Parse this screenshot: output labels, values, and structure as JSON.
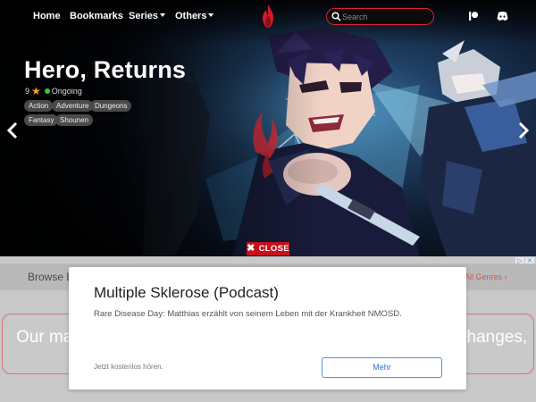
{
  "nav": {
    "links": [
      "Home",
      "Bookmarks",
      "Series",
      "Others"
    ],
    "search_placeholder": "Search",
    "icons": [
      "patreon-icon",
      "discord-icon"
    ],
    "logo": "flame-logo"
  },
  "hero": {
    "title": "Hero, Returns",
    "rating": "9",
    "status": "Ongoing",
    "genres": [
      "Action",
      "Adventure",
      "Dungeons",
      "Fantasy",
      "Shounen"
    ],
    "prev_icon": "chevron-left-icon",
    "next_icon": "chevron-right-icon"
  },
  "close_bar": {
    "label": "CLOSE"
  },
  "background_page": {
    "browse_label": "Browse B",
    "all_genres": "All Genres",
    "notice_left": "Our mai",
    "notice_right": "changes,"
  },
  "ad": {
    "title": "Multiple Sklerose (Podcast)",
    "description": "Rare Disease Day: Matthias erzählt von seinem Leben mit der Krankheit NMOSD.",
    "cta_text": "Jetzt kostenlos hören.",
    "button_label": "Mehr"
  },
  "colors": {
    "accent": "#e0202f",
    "close_bg": "#c81018",
    "status": "#2ecc40",
    "star": "#f5a623",
    "ad_button": "#2a73d6"
  }
}
